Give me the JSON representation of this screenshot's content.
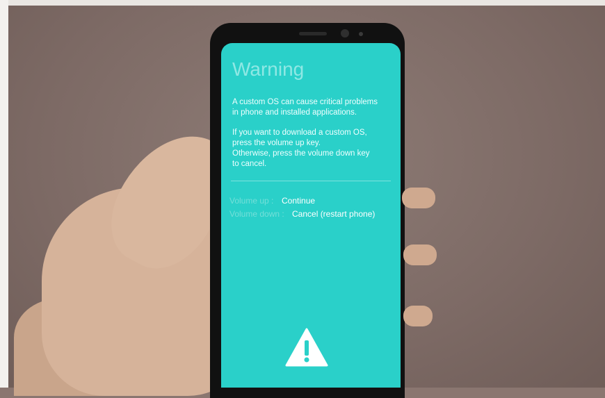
{
  "screen": {
    "title": "Warning",
    "message_lines": [
      "A custom OS can cause critical problems",
      "in phone and installed applications.",
      "If you want to download a custom OS,",
      "press the volume up key.",
      "Otherwise, press the volume down key",
      "to cancel."
    ],
    "options": [
      {
        "key": "Volume up :",
        "action": "Continue"
      },
      {
        "key": "Volume down :",
        "action": "Cancel (restart phone)"
      }
    ],
    "icon": "warning-triangle-icon",
    "background_color": "#2ad0c9"
  }
}
